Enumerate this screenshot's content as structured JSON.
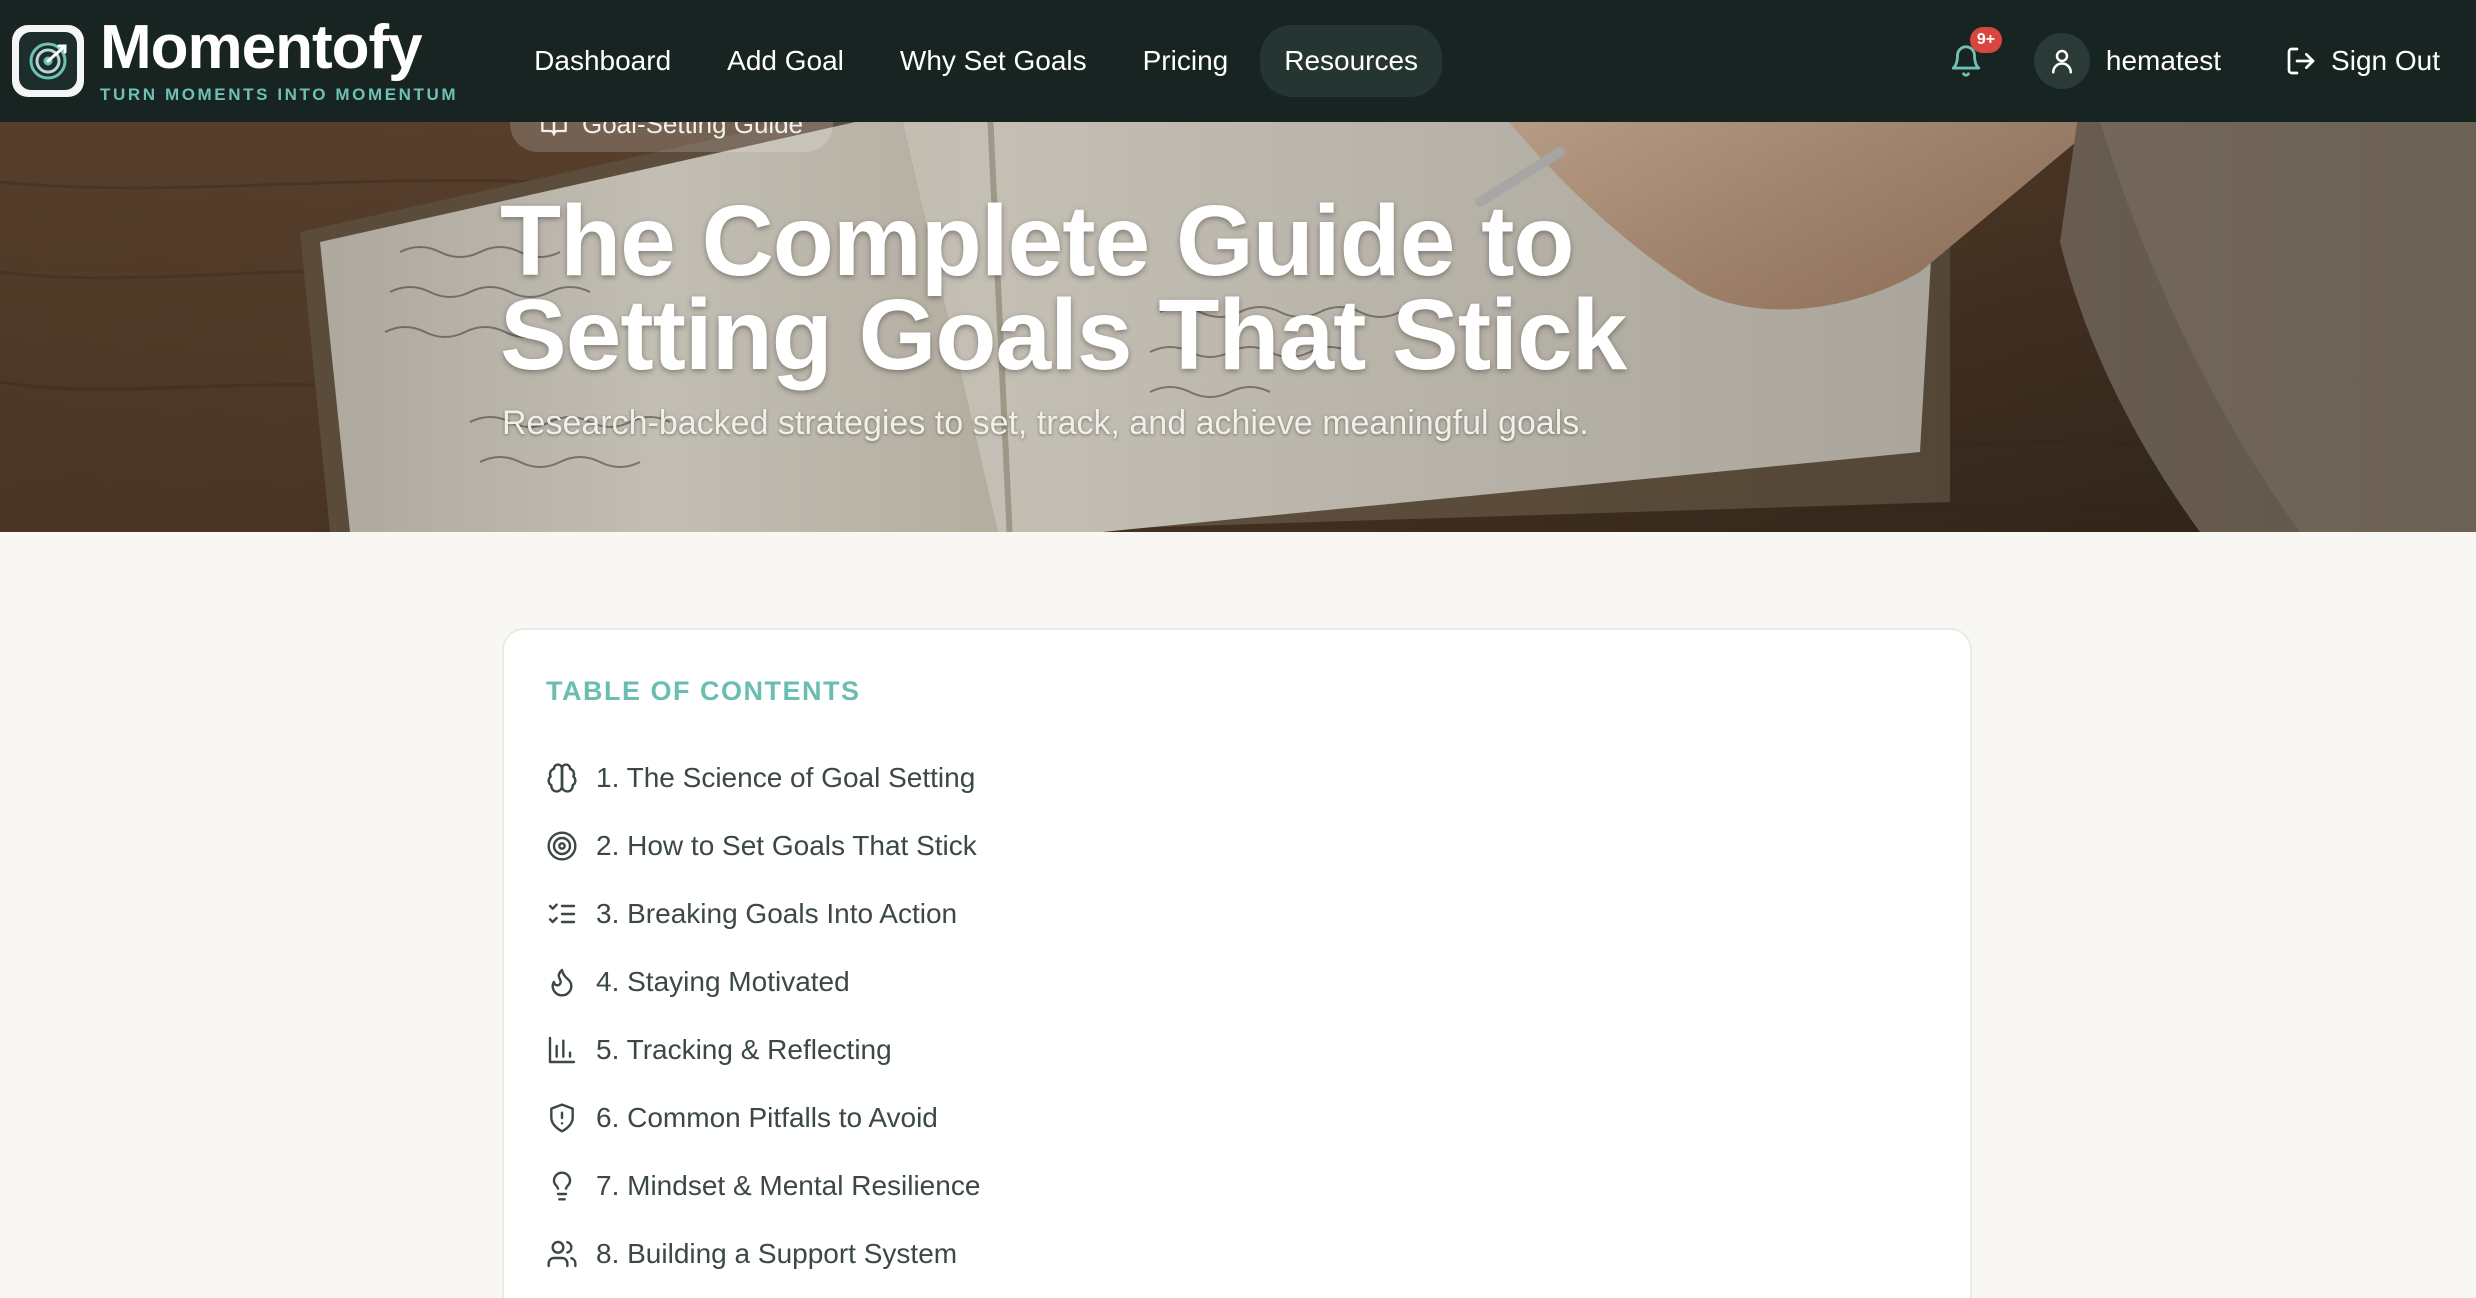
{
  "brand": {
    "name": "Momentofy",
    "tagline": "TURN MOMENTS INTO MOMENTUM"
  },
  "nav": {
    "links": [
      {
        "label": "Dashboard"
      },
      {
        "label": "Add Goal"
      },
      {
        "label": "Why Set Goals"
      },
      {
        "label": "Pricing"
      },
      {
        "label": "Resources",
        "active": true
      }
    ],
    "notification_badge": "9+",
    "username": "hematest",
    "signout_label": "Sign Out"
  },
  "hero": {
    "chip_label": "Goal-Setting Guide",
    "title_line1": "The Complete Guide to",
    "title_line2": "Setting Goals That Stick",
    "subtitle": "Research-backed strategies to set, track, and achieve meaningful goals."
  },
  "toc": {
    "title": "TABLE OF CONTENTS",
    "items": [
      {
        "label": "1. The Science of Goal Setting",
        "icon": "brain-icon"
      },
      {
        "label": "2. How to Set Goals That Stick",
        "icon": "target-icon"
      },
      {
        "label": "3. Breaking Goals Into Action",
        "icon": "list-checks-icon"
      },
      {
        "label": "4. Staying Motivated",
        "icon": "flame-icon"
      },
      {
        "label": "5. Tracking & Reflecting",
        "icon": "bar-chart-icon"
      },
      {
        "label": "6. Common Pitfalls to Avoid",
        "icon": "shield-alert-icon"
      },
      {
        "label": "7. Mindset & Mental Resilience",
        "icon": "lightbulb-icon"
      },
      {
        "label": "8. Building a Support System",
        "icon": "users-icon"
      }
    ]
  },
  "colors": {
    "nav_bg": "#172421",
    "accent": "#6ec1b4",
    "badge": "#d8473f",
    "page_bg": "#f8f7f3"
  }
}
